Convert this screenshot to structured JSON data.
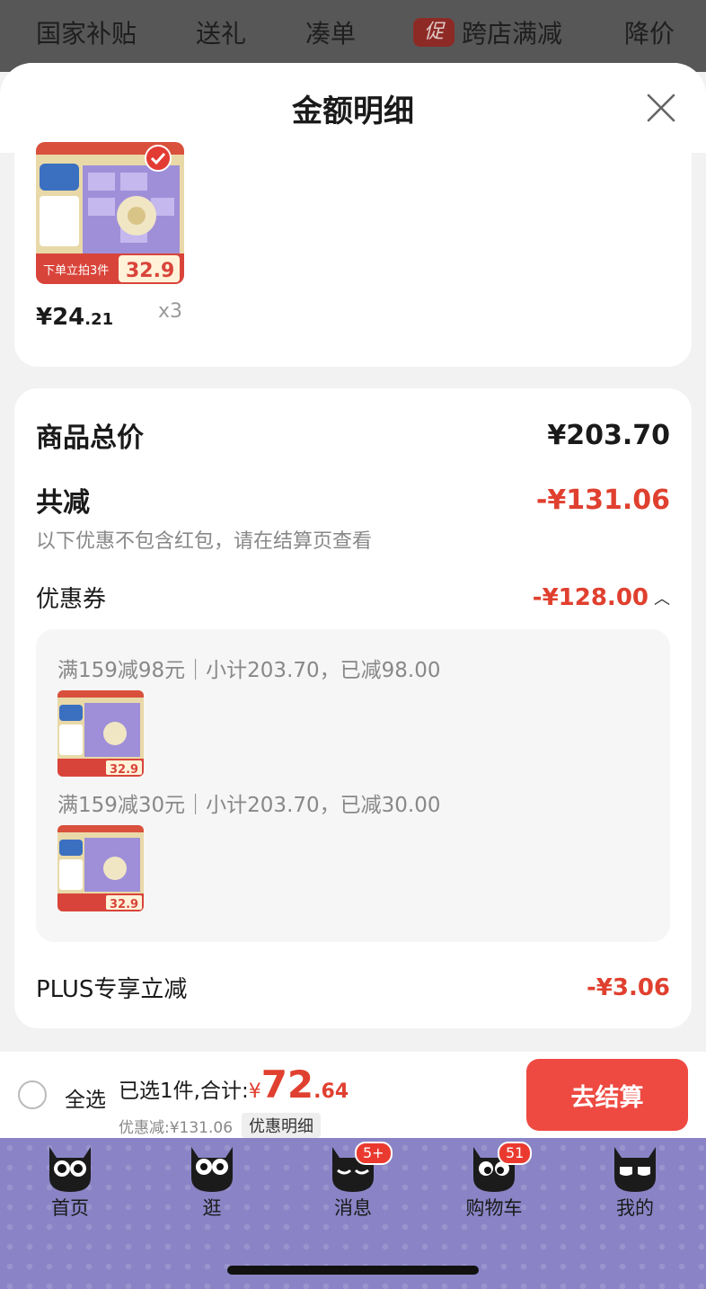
{
  "topbar": {
    "tabs": [
      "国家补贴",
      "送礼",
      "凑单",
      "跨店满减",
      "降价"
    ],
    "promo_icon_text": "促"
  },
  "sheet": {
    "title": "金额明细"
  },
  "product": {
    "price_main": "¥24",
    "price_dec": ".21",
    "quantity": "x3",
    "image_text_banner": "下单立拍3件",
    "image_text_price": "32.9"
  },
  "summary": {
    "total_label": "商品总价",
    "total_value": "¥203.70",
    "reduce_label": "共减",
    "reduce_value": "-¥131.06",
    "note": "以下优惠不包含红包，请在结算页查看",
    "coupon_label": "优惠券",
    "coupon_value": "-¥128.00",
    "coupons": [
      {
        "text": "满159减98元｜小计203.70，已减98.00"
      },
      {
        "text": "满159减30元｜小计203.70，已减30.00"
      }
    ],
    "plus_label": "PLUS专享立减",
    "plus_value": "-¥3.06"
  },
  "checkout": {
    "select_all": "全选",
    "selected_prefix": "已选1件,合计:",
    "yen": "¥",
    "sum_int": "72",
    "sum_dec": ".64",
    "discount_text": "优惠减:¥131.06",
    "detail_button": "优惠明细",
    "go_button": "去结算"
  },
  "tabbar": {
    "items": [
      {
        "label": "首页",
        "badge": ""
      },
      {
        "label": "逛",
        "badge": ""
      },
      {
        "label": "消息",
        "badge": "5+"
      },
      {
        "label": "购物车",
        "badge": "51"
      },
      {
        "label": "我的",
        "badge": ""
      }
    ]
  },
  "colors": {
    "accent_red": "#e0402f",
    "button_red": "#ee4a42",
    "tabbar_purple": "#8a84c6"
  }
}
